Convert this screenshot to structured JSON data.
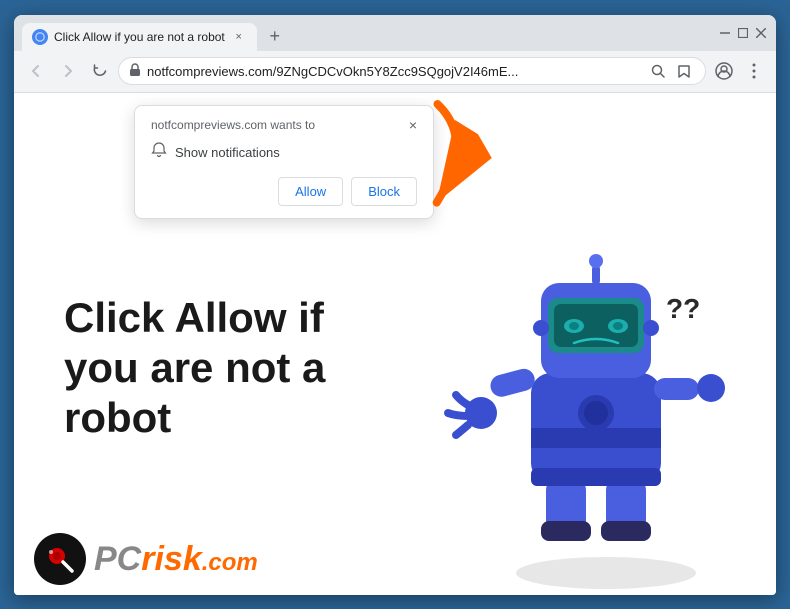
{
  "browser": {
    "tab": {
      "favicon": "🔵",
      "title": "Click Allow if you are not a robot",
      "close_label": "×"
    },
    "new_tab_label": "+",
    "window_controls": {
      "minimize": "—",
      "maximize": "□",
      "close": "×"
    },
    "nav": {
      "back_label": "←",
      "forward_label": "→",
      "reload_label": "↻",
      "lock_icon": "🔒",
      "address": "notfcompreviews.com/9ZNgCDCvOkn5Y8Zcc9SQgojV2I46mE...",
      "search_icon": "🔍",
      "bookmark_icon": "☆",
      "profile_icon": "👤",
      "menu_icon": "⋮"
    },
    "notification_popup": {
      "site_text": "notfcompreviews.com wants to",
      "bell_label": "🔔",
      "notification_label": "Show notifications",
      "close_label": "×",
      "allow_label": "Allow",
      "block_label": "Block"
    }
  },
  "page": {
    "main_heading": "Click Allow if you are not a robot",
    "arrow_color": "#ff6600"
  },
  "logo": {
    "pc_text": "PC",
    "risk_text": "risk",
    "com_text": ".com",
    "icon_emoji": "🔍"
  }
}
